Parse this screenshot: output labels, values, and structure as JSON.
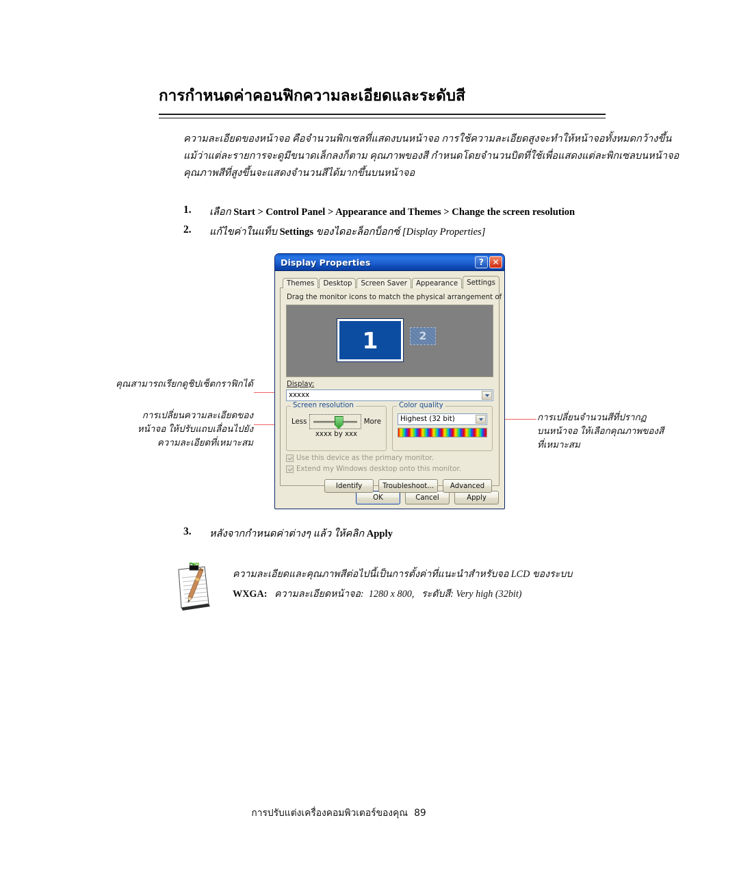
{
  "document": {
    "heading": "การกำหนดค่าคอนฟิกความละเอียดและระดับสี",
    "intro_lines": [
      "ความละเอียดของหน้าจอ คือจำนวนพิกเซลที่แสดงบนหน้าจอ การใช้ความละเอียดสูงจะทำให้หน้าจอทั้งหมดกว้างขึ้น",
      "แม้ว่าแต่ละรายการจะดูมีขนาดเล็กลงก็ตาม คุณภาพของสี กำหนดโดยจำนวนบิตที่ใช้เพื่อแสดงแต่ละพิกเซลบนหน้าจอ",
      "คุณภาพสีที่สูงขึ้นจะแสดงจำนวนสีได้มากขึ้นบนหน้าจอ"
    ]
  },
  "steps": [
    {
      "number": "1.",
      "text_prefix": "เลือก ",
      "text_bold": "Start > Control Panel > Appearance and Themes > Change the screen resolution",
      "text_suffix": ""
    },
    {
      "number": "2.",
      "text_prefix": "แก้ไขค่าในแท็บ ",
      "text_bold": "Settings",
      "text_suffix": " ของไดอะล็อกบ็อกซ์ [Display Properties]"
    },
    {
      "number": "3.",
      "text_prefix": "หลังจากกำหนดค่าต่างๆ แล้ว ให้คลิก ",
      "text_bold": "Apply",
      "text_suffix": ""
    }
  ],
  "callouts": {
    "left_top": "คุณสามารถเรียกดูชิปเซ็ตกราฟิกได้",
    "left_bottom_lines": [
      "การเปลี่ยนความละเอียดของ",
      "หน้าจอ ให้ปรับแถบเลื่อนไปยัง",
      "ความละเอียดที่เหมาะสม"
    ],
    "right_lines": [
      "การเปลี่ยนจำนวนสีที่ปรากฏ",
      "บนหน้าจอ ให้เลือกคุณภาพของสี",
      "ที่เหมาะสม"
    ]
  },
  "dialog": {
    "title": "Display Properties",
    "help_button": "?",
    "close_button": "✕",
    "tabs": [
      {
        "label": "Themes",
        "active": false
      },
      {
        "label": "Desktop",
        "active": false
      },
      {
        "label": "Screen Saver",
        "active": false
      },
      {
        "label": "Appearance",
        "active": false
      },
      {
        "label": "Settings",
        "active": true
      }
    ],
    "hint": "Drag the monitor icons to match the physical arrangement of your monitors.",
    "monitors": [
      {
        "number": "1",
        "selected": true
      },
      {
        "number": "2",
        "selected": false
      }
    ],
    "display_label": "Display:",
    "display_value": "xxxxx",
    "screen_resolution": {
      "legend": "Screen resolution",
      "less_label": "Less",
      "more_label": "More",
      "value": "xxxx by xxx"
    },
    "color_quality": {
      "legend": "Color quality",
      "value": "Highest (32 bit)"
    },
    "checkboxes": [
      {
        "label": "Use this device as the primary monitor.",
        "checked": true,
        "disabled": true
      },
      {
        "label": "Extend my Windows desktop onto this monitor.",
        "checked": true,
        "disabled": true
      }
    ],
    "action_buttons": [
      "Identify",
      "Troubleshoot...",
      "Advanced"
    ],
    "dialog_buttons": [
      "OK",
      "Cancel",
      "Apply"
    ]
  },
  "note": {
    "line1": "ความละเอียดและคุณภาพสีต่อไปนี้เป็นการตั้งค่าที่แนะนำสำหรับจอ LCD ของระบบ",
    "line2_label": "WXGA:",
    "line2_resolution_label": "ความละเอียดหน้าจอ:",
    "line2_resolution_value": "1280 x 800,",
    "line2_color_label": "ระดับสี:",
    "line2_color_value": "Very high (32bit)"
  },
  "footer": {
    "text": "การปรับแต่งเครื่องคอมพิวเตอร์ของคุณ",
    "page_number": "89"
  },
  "colors": {
    "titlebar_blue": "#1e60cf",
    "dialog_face": "#ece9d8",
    "monitor_blue": "#0d4da1",
    "callout_line": "#f06060",
    "slider_green": "#2f9d2f"
  }
}
